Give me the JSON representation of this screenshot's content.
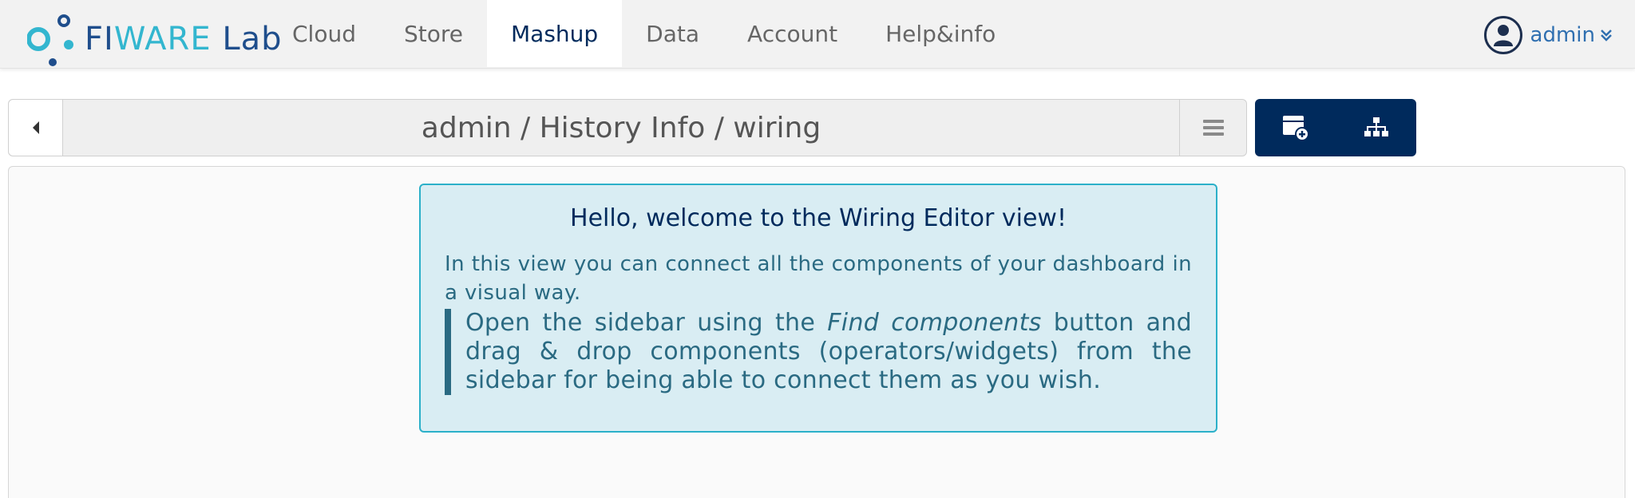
{
  "navbar": {
    "logo": {
      "part1": "FI",
      "part2": "WARE",
      "part3": "Lab",
      "colors": {
        "dark": "#1f4e8c",
        "light": "#33b6cf"
      }
    },
    "tabs": [
      {
        "label": "Cloud",
        "active": false
      },
      {
        "label": "Store",
        "active": false
      },
      {
        "label": "Mashup",
        "active": true
      },
      {
        "label": "Data",
        "active": false
      },
      {
        "label": "Account",
        "active": false
      },
      {
        "label": "Help&info",
        "active": false
      }
    ],
    "user": {
      "name": "admin",
      "icon": "user-avatar-icon",
      "menu_icon": "double-chevron-down-icon"
    }
  },
  "toolbar": {
    "back_icon": "caret-left-icon",
    "breadcrumb": "admin / History Info / wiring",
    "menu_icon": "hamburger-icon",
    "actions": [
      {
        "name": "find-components",
        "icon": "add-component-icon"
      },
      {
        "name": "behaviours",
        "icon": "sitemap-icon"
      }
    ],
    "accent_color": "#002a5c"
  },
  "welcome": {
    "title": "Hello, welcome to the Wiring Editor view!",
    "text": "In this view you can connect all the components of your dashboard in a visual way.",
    "quote_before": "Open the sidebar using the ",
    "quote_emphasis": "Find components",
    "quote_after": " button and drag & drop components (operators/widgets) from the sidebar for being able to connect them as you wish.",
    "colors": {
      "background": "#d9edf3",
      "border": "#2bb0c9",
      "text": "#2a6a82"
    }
  }
}
